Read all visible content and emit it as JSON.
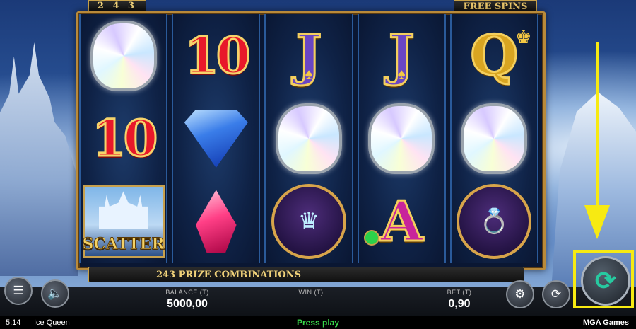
{
  "game": {
    "title": "Ice Queen",
    "ways_counter": "2 4 3",
    "free_spins_label": "FREE SPINS",
    "prize_text": "243 PRIZE COMBINATIONS"
  },
  "reels": [
    [
      "diamond-white",
      "10",
      "SCATTER"
    ],
    [
      "10",
      "gem-blue",
      "gem-pink"
    ],
    [
      "J",
      "diamond-white",
      "tiara"
    ],
    [
      "J",
      "diamond-white",
      "A"
    ],
    [
      "Q",
      "diamond-white",
      "ring"
    ]
  ],
  "labels": {
    "num10": "10",
    "J": "J",
    "Q": "Q",
    "A": "A",
    "scatter": "SCATTER"
  },
  "hud": {
    "balance_label": "BALANCE (T)",
    "balance_value": "5000,00",
    "win_label": "WIN (T)",
    "win_value": "",
    "bet_label": "BET (T)",
    "bet_value": "0,90"
  },
  "status": {
    "time": "5:14",
    "press_play": "Press play",
    "brand": "MGA Games"
  },
  "icons": {
    "menu": "menu-icon",
    "sound": "speaker-icon",
    "bet_settings": "chip-icon",
    "autoplay": "autoplay-icon",
    "spin": "spin-icon"
  },
  "colors": {
    "accent_gold": "#c8a24a",
    "annotation_yellow": "#f7ea12",
    "press_play_green": "#38d84a",
    "spin_teal": "#27c9a0"
  }
}
